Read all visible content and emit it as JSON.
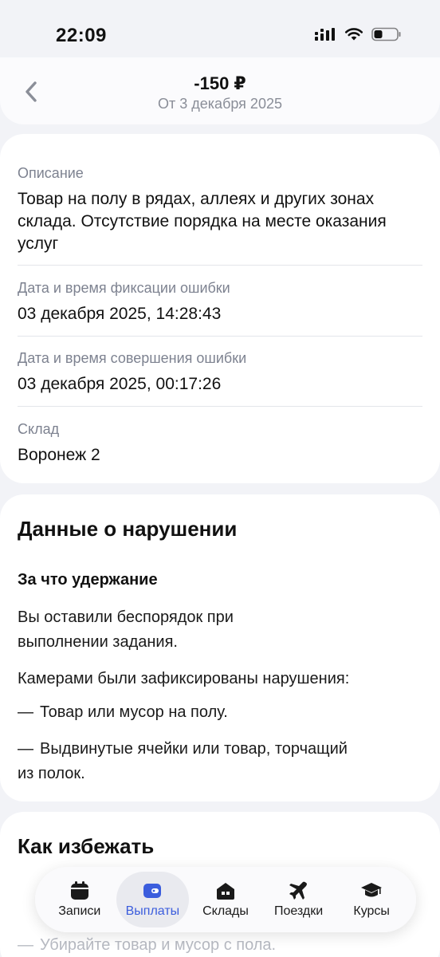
{
  "status_bar": {
    "time": "22:09"
  },
  "header": {
    "title": "-150 ₽",
    "subtitle": "От 3 декабря 2025"
  },
  "details": [
    {
      "label": "Описание",
      "value": "Товар на полу в рядах, аллеях и других зонах склада. Отсутствие порядка на месте оказания услуг"
    },
    {
      "label": "Дата и время фиксации ошибки",
      "value": "03 декабря 2025, 14:28:43"
    },
    {
      "label": "Дата и время совершения ошибки",
      "value": "03 декабря 2025, 00:17:26"
    },
    {
      "label": "Склад",
      "value": "Воронеж 2"
    }
  ],
  "violation": {
    "title": "Данные о нарушении",
    "subtitle": "За что удержание",
    "paragraph1_line1": "Вы оставили беспорядок при",
    "paragraph1_line2": "выполнении задания.",
    "paragraph2": "Камерами были зафиксированы нарушения:",
    "dash": "—",
    "item1": "Товар или мусор на полу.",
    "item2_line1": "Выдвинутые ячейки или товар, торчащий",
    "item2_line2": "из полок."
  },
  "avoid": {
    "title_line1": "Как избежать",
    "faded_item": "Убирайте товар и мусор с пола."
  },
  "nav": {
    "items": [
      {
        "label": "Записи",
        "icon": "calendar-icon",
        "active": false
      },
      {
        "label": "Выплаты",
        "icon": "wallet-icon",
        "active": true
      },
      {
        "label": "Склады",
        "icon": "warehouse-icon",
        "active": false
      },
      {
        "label": "Поездки",
        "icon": "airplane-icon",
        "active": false
      },
      {
        "label": "Курсы",
        "icon": "graduation-cap-icon",
        "active": false
      }
    ]
  },
  "colors": {
    "accent": "#3b5ddd",
    "background": "#f2f3f7",
    "muted": "#7d8290"
  }
}
